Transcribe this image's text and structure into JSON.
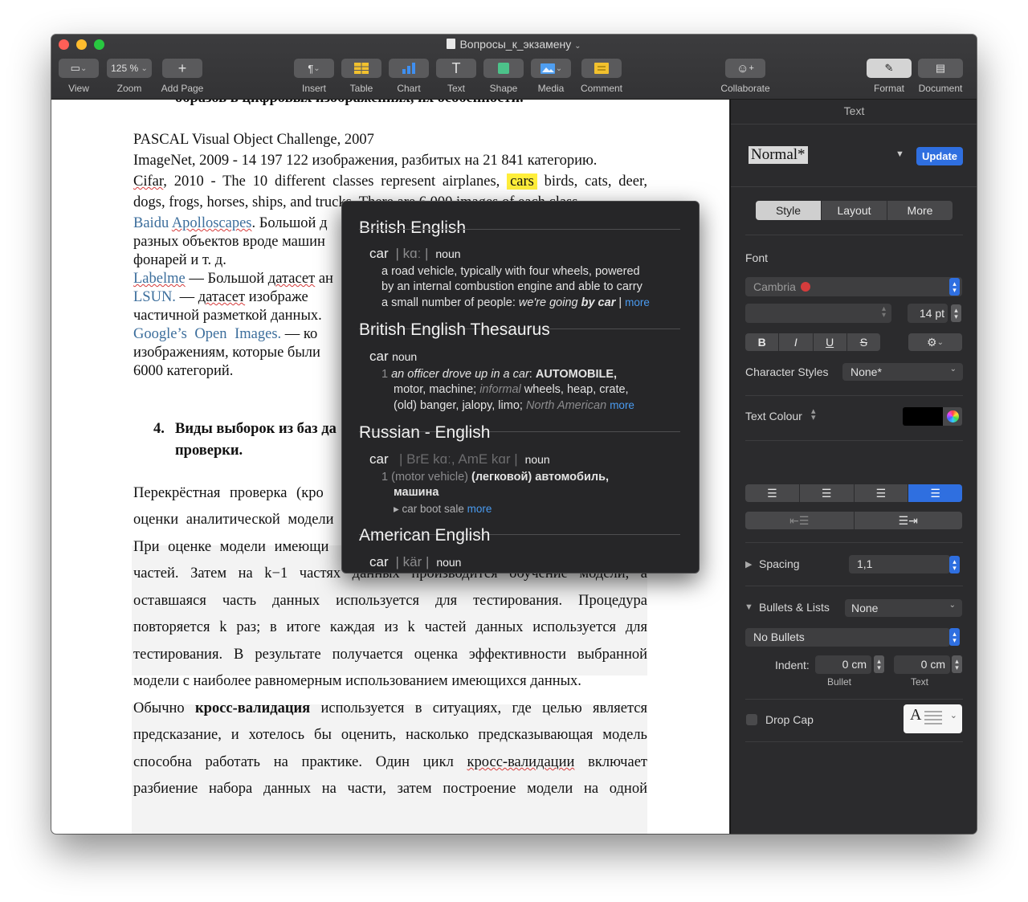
{
  "window": {
    "title": "Вопросы_к_экзамену"
  },
  "toolbar": {
    "view": "View",
    "zoom_value": "125 %",
    "zoom": "Zoom",
    "add_page": "Add Page",
    "insert": "Insert",
    "table": "Table",
    "chart": "Chart",
    "text": "Text",
    "shape": "Shape",
    "media": "Media",
    "comment": "Comment",
    "collaborate": "Collaborate",
    "format": "Format",
    "document": "Document"
  },
  "doc": {
    "top_cut": "образов в цифровых изображениях, их особенности.",
    "l1": "PASCAL Visual Object Challenge, 2007",
    "l2": "ImageNet, 2009 - 14 197 122 изображения, разбитых на 21 841 категорию.",
    "l3a": "Cifar",
    "l3b": ", 2010 - The 10 different classes represent airplanes,",
    "l3hl": "cars",
    "l3c": "birds, cats, deer,",
    "l4": "dogs, frogs, horses, ships, and trucks. There are 6,000 images of each class.",
    "l5a": "Baidu",
    "l5b": "Apolloscapes",
    "l5c": ". Большой д",
    "l6": "разных объектов вроде машин",
    "l7": "фонарей и т. д.",
    "l8a": "Labelme",
    "l8b": " — Большой ",
    "l8c": "датасет",
    "l8d": " ан",
    "l9a": "LSUN.",
    "l9b": " — ",
    "l9c": "датасет",
    "l9d": " изображе",
    "l10": "частичной разметкой данных.",
    "l11a": "Google’s Open Images.",
    "l11b": " — ко",
    "l12": "изображениям, которые были",
    "l13": "6000 категорий.",
    "h4num": "4.",
    "h4a": "Виды выборок из баз да",
    "h4b": "проверки.",
    "p1": "Перекрёстная проверка (кро",
    "p2": "оценки аналитической модели",
    "p3": "При оценке модели имеющи",
    "p4": "частей. Затем на k−1 частях данных производится обучение модели, а",
    "p5": "оставшаяся часть данных используется для тестирования. Процедура",
    "p6": "повторяется k раз; в итоге каждая из k частей данных используется для",
    "p7": "тестирования. В результате получается оценка эффективности выбранной",
    "p8": "модели с наиболее равномерным использованием имеющихся данных.",
    "p9a": "Обычно ",
    "p9b": "кросс-валидация",
    "p9c": " используется в ситуациях, где целью является",
    "p10": "предсказание, и хотелось бы оценить, насколько предсказывающая модель",
    "p11a": "способна работать на практике. Один цикл ",
    "p11b": "кросс-валидации",
    "p11c": " включает",
    "p12": "разбиение набора данных на части, затем построение модели на одной"
  },
  "lookup": {
    "s1_title": "British English",
    "s1_word": "car",
    "s1_pron": "| kɑː |",
    "s1_pos": "noun",
    "s1_d1": "a road vehicle, typically with four wheels, powered",
    "s1_d2": "by an internal combustion engine and able to carry",
    "s1_d3a": "a small number of people: ",
    "s1_d3b": "we're going ",
    "s1_d3c": "by car",
    "s1_d3d": " | ",
    "s1_more": "more",
    "s2_title": "British English Thesaurus",
    "s2_word": "car",
    "s2_pos": "noun",
    "s2_num": "1",
    "s2_d1a": "an officer drove up in a car",
    "s2_d1b": ": ",
    "s2_d1c": "AUTOMOBILE,",
    "s2_d2a": "motor, machine; ",
    "s2_d2b": "informal",
    "s2_d2c": " wheels, heap, crate,",
    "s2_d3a": "(old) banger, jalopy, limo; ",
    "s2_d3b": "North American",
    "s2_more": "more",
    "s3_title": "Russian - English",
    "s3_word": "car",
    "s3_pron": "| BrE kɑː, AmE kɑr |",
    "s3_pos": "noun",
    "s3_num": "1",
    "s3_d1a": "(motor vehicle) ",
    "s3_d1b": "(легковой) автомобиль,",
    "s3_d2": "машина",
    "s3_sub": "▸ car boot sale",
    "s3_more": "more",
    "s4_title": "American English",
    "s4_word": "car",
    "s4_pron": "| kär |",
    "s4_pos": "noun"
  },
  "sidebar": {
    "header": "Text",
    "style_name": "Normal*",
    "update": "Update",
    "tabs": [
      "Style",
      "Layout",
      "More"
    ],
    "font_label": "Font",
    "font_name": "Cambria",
    "font_size": "14 pt",
    "bold": "B",
    "italic": "I",
    "underline": "U",
    "strike": "S",
    "char_styles_label": "Character Styles",
    "char_styles_value": "None*",
    "text_colour_label": "Text Colour",
    "text_colour": "#000000",
    "spacing_label": "Spacing",
    "spacing_value": "1,1",
    "bullets_label": "Bullets & Lists",
    "bullets_value": "None",
    "bullets_style": "No Bullets",
    "indent_label": "Indent:",
    "indent_bullet": "0 cm",
    "indent_text": "0 cm",
    "indent_bullet_caption": "Bullet",
    "indent_text_caption": "Text",
    "dropcap_label": "Drop Cap",
    "dropcap_letter": "A"
  },
  "colors": {
    "accent": "#2f6fe0",
    "highlight": "#ffee3a",
    "link": "#3c6e9c",
    "more_link": "#4a9bf0"
  }
}
